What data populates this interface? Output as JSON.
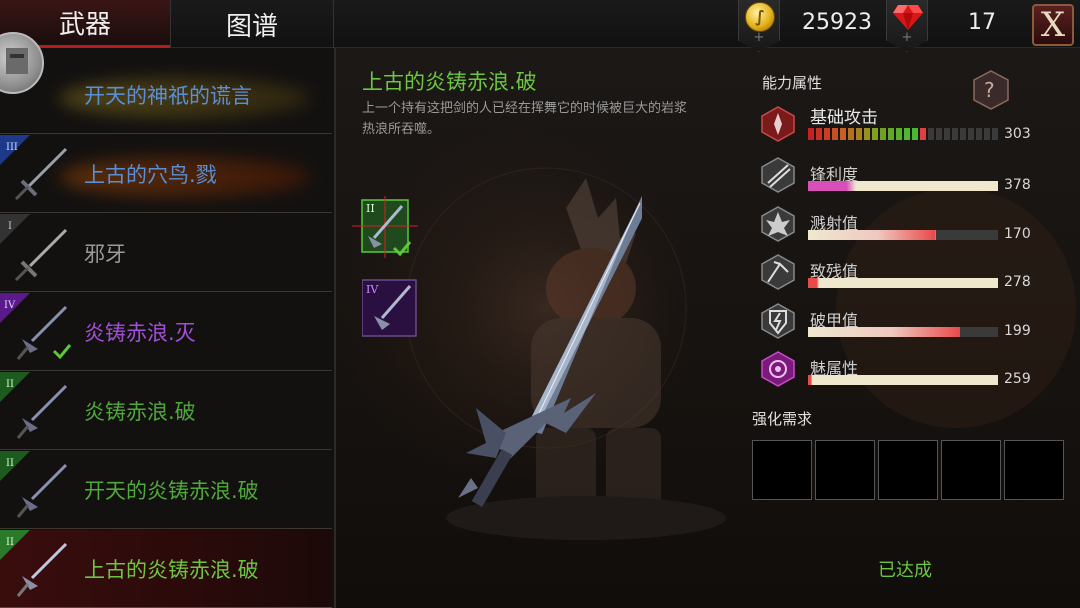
{
  "tabs": {
    "weapons": "武器",
    "atlas": "图谱"
  },
  "currency": {
    "gold": "25923",
    "gems": "17",
    "plus": "+"
  },
  "close_label": "X",
  "weapon_list": [
    {
      "name": "开天的神祇的谎言",
      "tier": "",
      "color": "#5a8ed6",
      "check": false
    },
    {
      "name": "上古的穴鸟.戮",
      "tier": "III",
      "color": "#5a8ed6",
      "check": false
    },
    {
      "name": "邪牙",
      "tier": "I",
      "color": "#9a9a9a",
      "check": false
    },
    {
      "name": "炎铸赤浪.灭",
      "tier": "IV",
      "color": "#a24fd8",
      "check": true
    },
    {
      "name": "炎铸赤浪.破",
      "tier": "II",
      "color": "#4fa83a",
      "check": false
    },
    {
      "name": "开天的炎铸赤浪.破",
      "tier": "II",
      "color": "#4fa83a",
      "check": false
    },
    {
      "name": "上古的炎铸赤浪.破",
      "tier": "II",
      "color": "#6cc641",
      "check": false
    }
  ],
  "detail": {
    "title": "上古的炎铸赤浪.破",
    "description": "上一个持有这把剑的人已经在挥舞它的时候被巨大的岩浆热浪所吞噬。",
    "slots": [
      {
        "tier": "II",
        "check": true
      },
      {
        "tier": "IV",
        "check": false
      }
    ]
  },
  "attributes": {
    "header": "能力属性",
    "help_symbol": "?",
    "base_attack": {
      "name": "基础攻击",
      "value": "303",
      "segments_total": 24,
      "segments_filled": 15
    },
    "list": [
      {
        "name": "锋利度",
        "value": "378",
        "fill": 0.25,
        "color": "#d84fb8",
        "icon": "sharpness-icon"
      },
      {
        "name": "溅射值",
        "value": "170",
        "fill": 0.67,
        "color": "#e84a4a",
        "icon": "splash-icon"
      },
      {
        "name": "致残值",
        "value": "278",
        "fill": 0.06,
        "color": "#e84a4a",
        "icon": "cripple-icon"
      },
      {
        "name": "破甲值",
        "value": "199",
        "fill": 0.8,
        "color": "#e84a4a",
        "icon": "armor-break-icon"
      },
      {
        "name": "魅属性",
        "value": "259",
        "fill": 0.02,
        "color": "#e84a4a",
        "icon": "charm-icon"
      }
    ]
  },
  "requirements": {
    "header": "强化需求",
    "status": "已达成"
  }
}
